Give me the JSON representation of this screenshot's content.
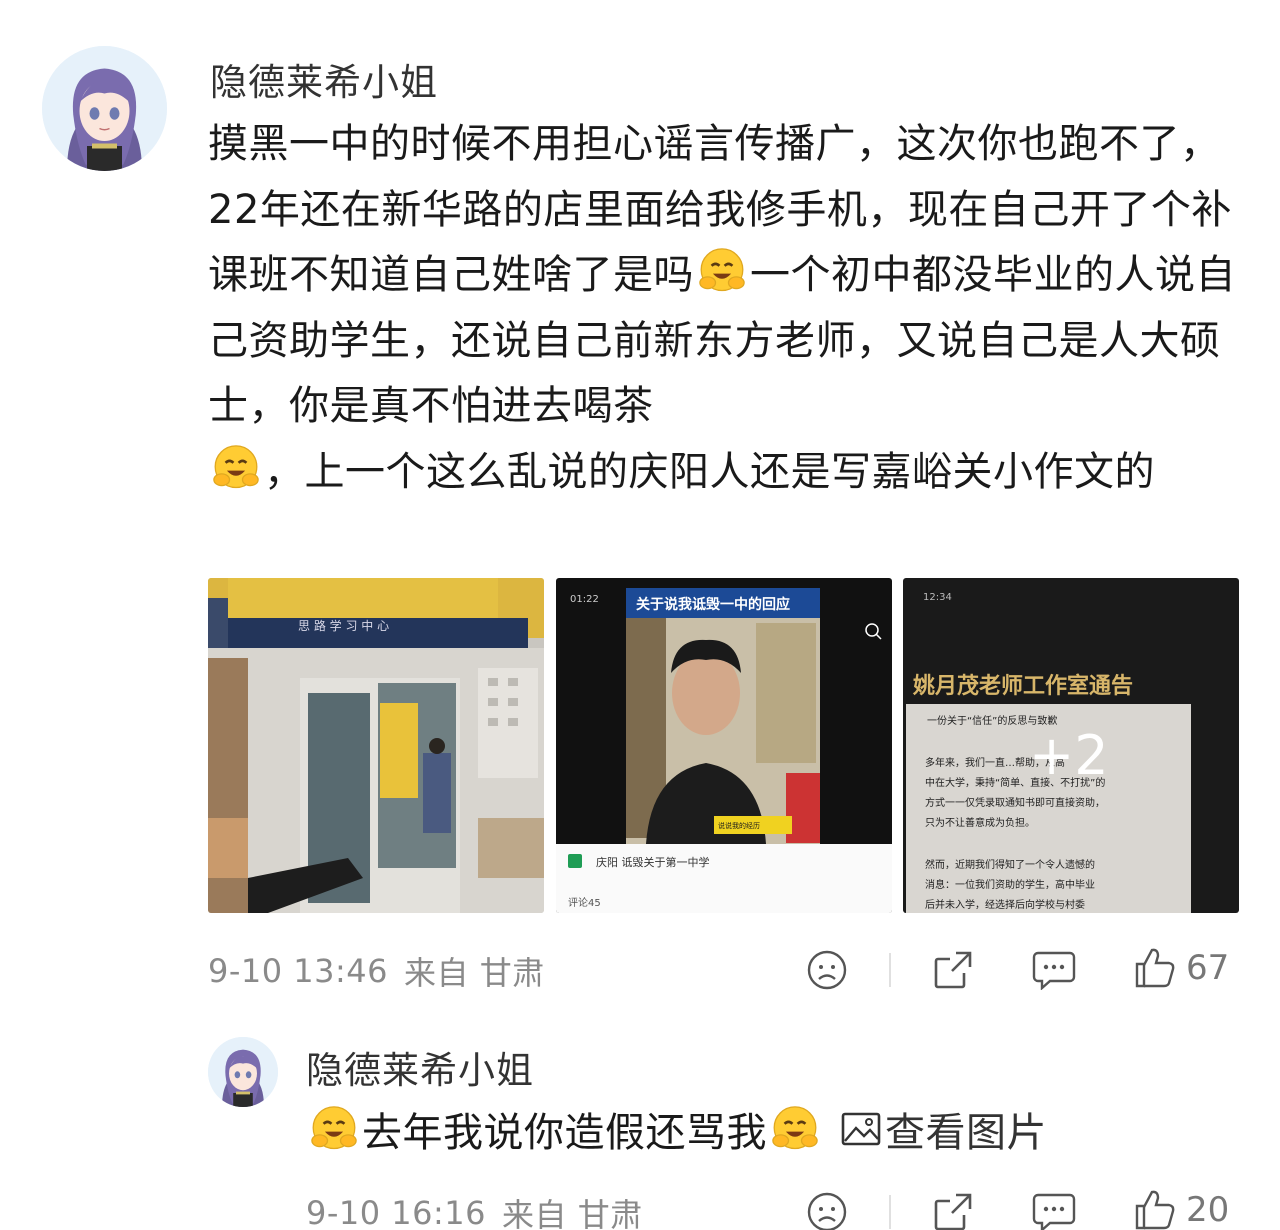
{
  "post": {
    "username": "隐德莱希小姐",
    "segments": [
      "摸黑一中的时候不用担心谣言传播广，这次你也跑不了，22年还在新华路的店里面给我修手机，现在自己开了个补课班不知道自己姓啥了是吗",
      "一个初中都没毕业的人说自己资助学生，还说自己前新东方老师，又说自己是人大硕士，你是真不怕进去喝茶",
      "，上一个这么乱说的庆阳人还是写嘉峪关小作文的"
    ],
    "images": [
      {
        "desc": "storefront"
      },
      {
        "title": "关于说我诋毁一中的回应",
        "status_time": "01:22",
        "bottom_text": "庆阳 诋毁关于第一中学"
      },
      {
        "title": "姚月茂老师工作室通告",
        "more_count": "+2",
        "line1": "一份关于“信任”的反思与致歉",
        "line2": "多年来，我们一直…帮助，从高",
        "line3": "中在大学，秉持“简单、直接、不打扰”的",
        "line4": "方式一一仅凭录取通知书即可直接资助，",
        "line5": "只为不让善意成为负担。",
        "line6": "然而，近期我们得知了一个令人遗憾的",
        "line7": "消息：一位我们资助的学生，高中毕业",
        "line8": "后并未入学，经选择后向学校与村委"
      }
    ],
    "timestamp": "9-10 13:46",
    "location": "来自 甘肃",
    "like_count": "67"
  },
  "reply": {
    "username": "隐德莱希小姐",
    "text": "去年我说你造假还骂我",
    "view_image_label": "查看图片",
    "timestamp": "9-10 16:16",
    "location": "来自 甘肃",
    "like_count": "20"
  }
}
